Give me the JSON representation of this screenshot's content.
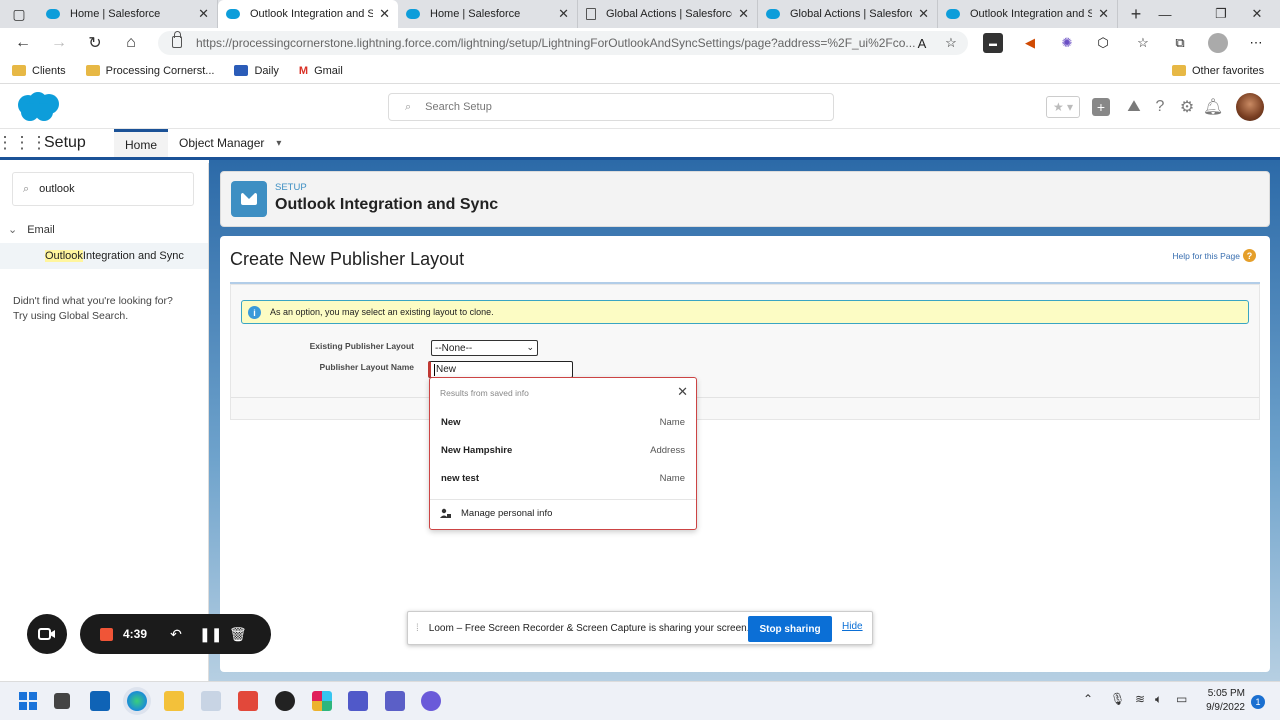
{
  "browser": {
    "tabs": [
      {
        "title": "Home | Salesforce",
        "icon": "salesforce-cloud-icon",
        "active": false
      },
      {
        "title": "Outlook Integration and Sy",
        "icon": "salesforce-cloud-icon",
        "active": true
      },
      {
        "title": "Home | Salesforce",
        "icon": "salesforce-cloud-icon",
        "active": false
      },
      {
        "title": "Global Actions | Salesforce",
        "icon": "document-icon",
        "active": false
      },
      {
        "title": "Global Actions | Salesforce",
        "icon": "salesforce-cloud-icon",
        "active": false
      },
      {
        "title": "Outlook Integration and Sy",
        "icon": "salesforce-cloud-icon",
        "active": false
      }
    ],
    "url": "https://processingcornerstone.lightning.force.com/lightning/setup/LightningForOutlookAndSyncSettings/page?address=%2F_ui%2Fco...",
    "bookmarks": [
      "Clients",
      "Processing Cornerst...",
      "Daily",
      "Gmail"
    ],
    "other_favorites": "Other favorites"
  },
  "header": {
    "search_placeholder": "Search Setup"
  },
  "appnav": {
    "title": "Setup",
    "tabs": [
      "Home",
      "Object Manager"
    ]
  },
  "sidebar": {
    "quick_find": "outlook",
    "group": "Email",
    "item_highlight": "Outlook",
    "item_rest": " Integration and Sync",
    "not_found_line1": "Didn't find what you're looking for?",
    "not_found_line2": "Try using Global Search."
  },
  "page": {
    "eyebrow": "SETUP",
    "title": "Outlook Integration and Sync",
    "content_title": "Create New Publisher Layout",
    "help_link": "Help for this Page",
    "info_message": "As an option, you may select an existing layout to clone.",
    "existing_layout_label": "Existing Publisher Layout",
    "existing_layout_value": "--None--",
    "layout_name_label": "Publisher Layout Name",
    "layout_name_value": "New"
  },
  "autofill": {
    "header": "Results from saved info",
    "rows": [
      {
        "value": "New",
        "kind": "Name"
      },
      {
        "value": "New Hampshire",
        "kind": "Address"
      },
      {
        "value": "new test",
        "kind": "Name"
      }
    ],
    "manage": "Manage personal info"
  },
  "loom": {
    "timer": "4:39",
    "share_message": "Loom – Free Screen Recorder & Screen Capture is sharing your screen.",
    "stop_label": "Stop sharing",
    "hide_label": "Hide"
  },
  "taskbar": {
    "time": "5:05 PM",
    "date": "9/9/2022",
    "notifications": "1"
  }
}
